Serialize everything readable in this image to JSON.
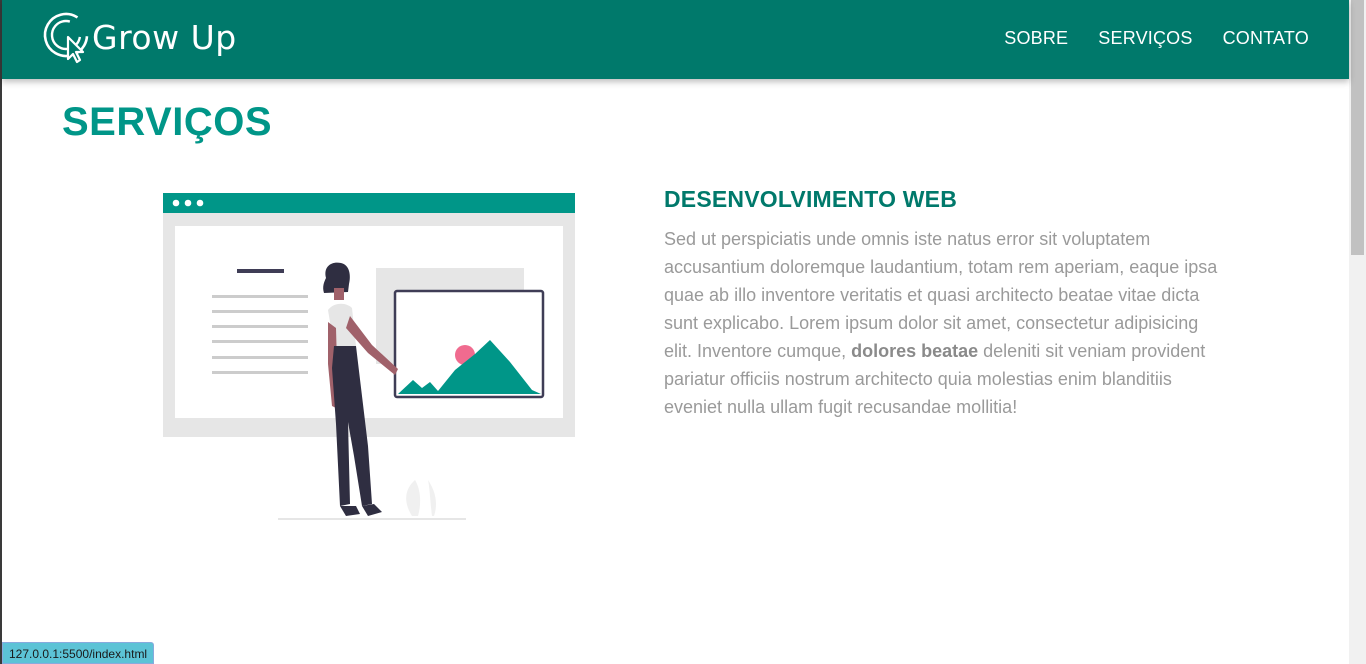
{
  "header": {
    "brand": "Grow Up",
    "nav": [
      {
        "label": "SOBRE"
      },
      {
        "label": "SERVIÇOS"
      },
      {
        "label": "CONTATO"
      }
    ],
    "bg_color": "#00796b"
  },
  "main": {
    "title": "SERVIÇOS",
    "service": {
      "title": "DESENVOLVIMENTO WEB",
      "text_before_bold": "Sed ut perspiciatis unde omnis iste natus error sit voluptatem accusantium doloremque laudantium, totam rem aperiam, eaque ipsa quae ab illo inventore veritatis et quasi architecto beatae vitae dicta sunt explicabo. Lorem ipsum dolor sit amet, consectetur adipisicing elit. Inventore cumque, ",
      "text_bold": "dolores beatae",
      "text_after_bold": " deleniti sit veniam provident pariatur officiis nostrum architecto quia molestias enim blanditiis eveniet nulla ullam fugit recusandae mollitia!"
    },
    "accent_color": "#009688"
  },
  "statusbar": {
    "url": "127.0.0.1:5500/index.html"
  },
  "icons": {
    "logo": "cursor-click-icon",
    "illustration": "web-development-illustration"
  }
}
